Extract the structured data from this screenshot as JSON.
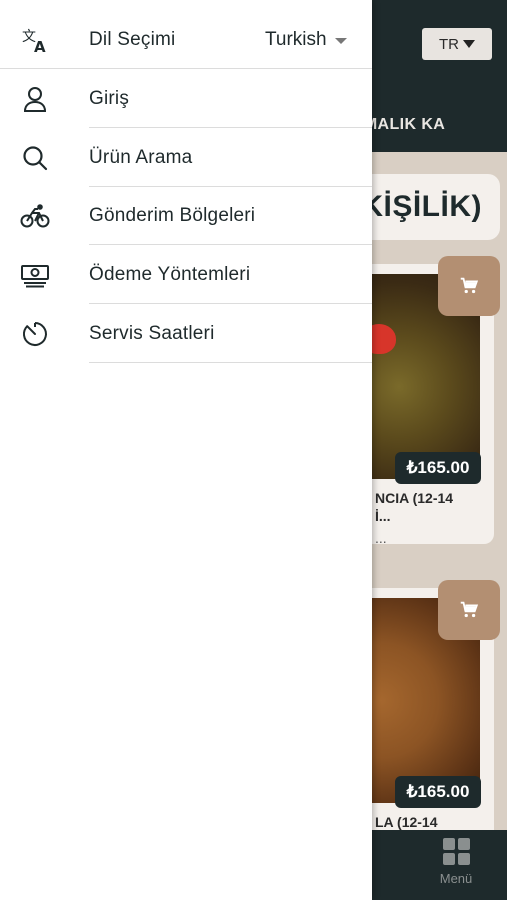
{
  "background": {
    "language_button": "TR",
    "category_text": "ATIŞTIRMALIK KA",
    "section_title": "KİŞİLİK)",
    "products": [
      {
        "price": "₺165.00",
        "name_line1": "NCIA (12-14",
        "name_line2": "İ...",
        "desc": "..."
      },
      {
        "price": "₺165.00",
        "name_line1": "LA (12-14",
        "name_line2": "",
        "desc": ""
      }
    ],
    "bottom_tab_label": "Menü"
  },
  "drawer": {
    "language": {
      "label": "Dil Seçimi",
      "value": "Turkish",
      "icon": "translate-icon"
    },
    "items": [
      {
        "label": "Giriş",
        "icon": "user-icon"
      },
      {
        "label": "Ürün Arama",
        "icon": "search-icon"
      },
      {
        "label": "Gönderim Bölgeleri",
        "icon": "bicycle-icon"
      },
      {
        "label": "Ödeme Yöntemleri",
        "icon": "cash-icon"
      },
      {
        "label": "Servis Saatleri",
        "icon": "timer-icon"
      }
    ]
  },
  "colors": {
    "dark": "#1e2a2c",
    "accent": "#b38f72",
    "content_bg": "#d9cfc4"
  }
}
